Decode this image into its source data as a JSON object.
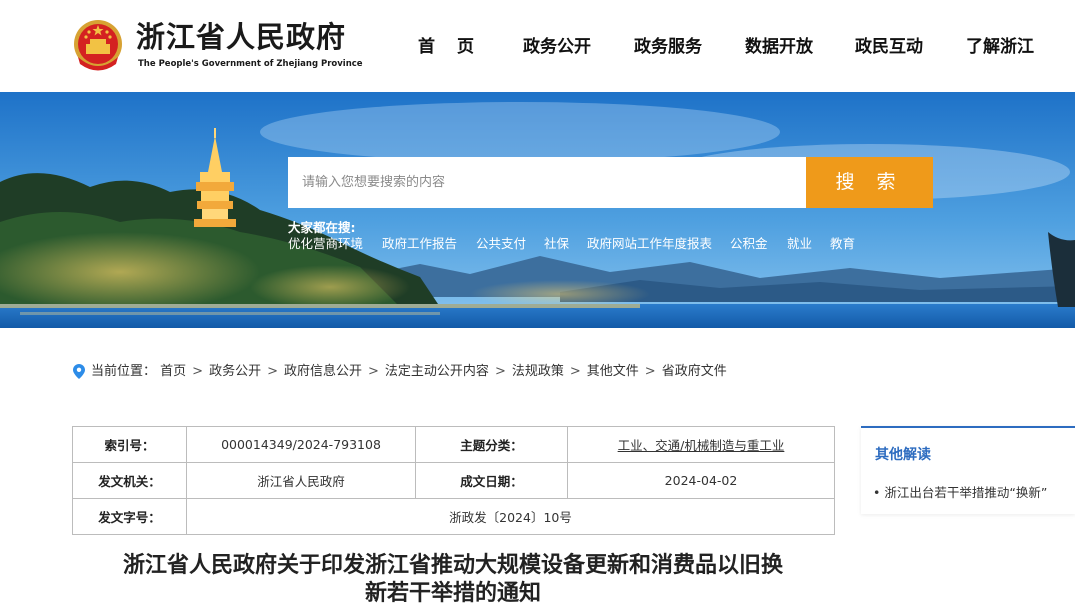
{
  "header": {
    "site_title": "浙江省人民政府",
    "site_subtitle": "The People's Government of Zhejiang Province",
    "nav": [
      "首页",
      "政务公开",
      "政务服务",
      "数据开放",
      "政民互动",
      "了解浙江"
    ]
  },
  "search": {
    "placeholder": "请输入您想要搜索的内容",
    "button_label": "搜 索",
    "hot_title": "大家都在搜:",
    "hot_links": [
      "优化营商环境",
      "政府工作报告",
      "公共支付",
      "社保",
      "政府网站工作年度报表",
      "公积金",
      "就业",
      "教育"
    ]
  },
  "breadcrumb": {
    "prefix": "当前位置：",
    "items": [
      "首页",
      "政务公开",
      "政府信息公开",
      "法定主动公开内容",
      "法规政策",
      "其他文件",
      "省政府文件"
    ],
    "separator": ">"
  },
  "meta": {
    "index_label": "索引号：",
    "index_value": "000014349/2024-793108",
    "topic_label": "主题分类：",
    "topic_value": "工业、交通/机械制造与重工业",
    "issuer_label": "发文机关：",
    "issuer_value": "浙江省人民政府",
    "date_label": "成文日期：",
    "date_value": "2024-04-02",
    "docno_label": "发文字号：",
    "docno_value": "浙政发〔2024〕10号"
  },
  "article": {
    "title_line1": "浙江省人民政府关于印发浙江省推动大规模设备更新和消费品以旧换",
    "title_line2": "新若干举措的通知"
  },
  "sidebar": {
    "heading": "其他解读",
    "items": [
      "浙江出台若干举措推动“换新”"
    ]
  },
  "colors": {
    "accent_orange": "#ef9a1a",
    "accent_blue": "#2d6cc0"
  }
}
